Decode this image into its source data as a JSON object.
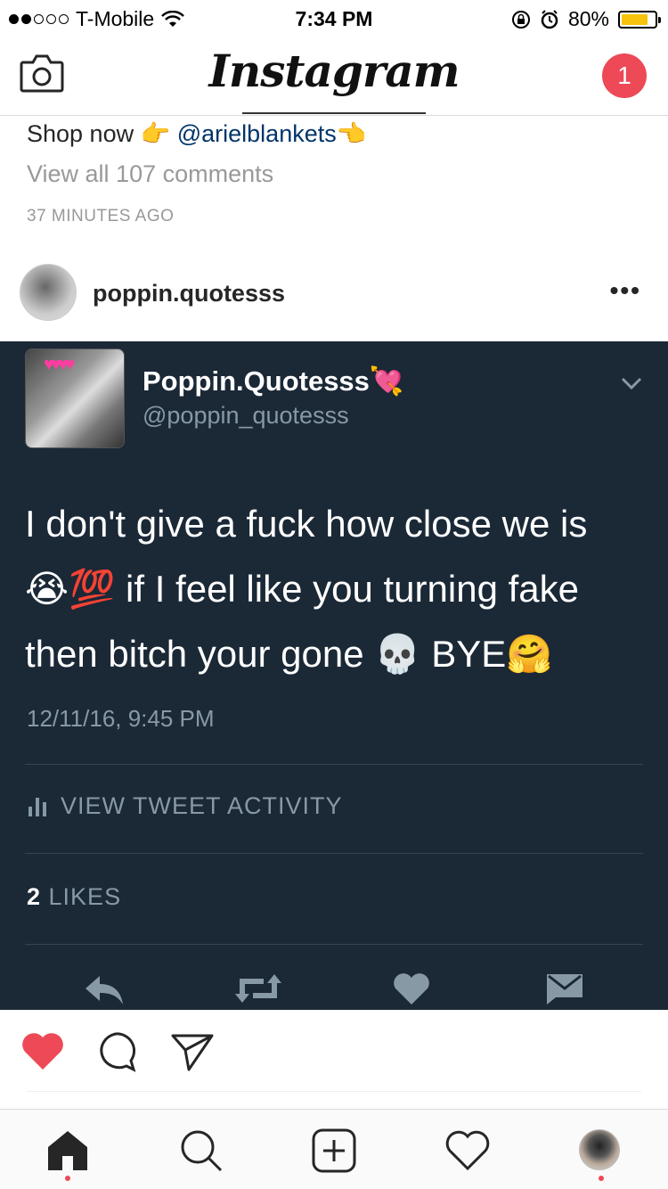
{
  "status_bar": {
    "carrier": "T-Mobile",
    "time": "7:34 PM",
    "battery": "80%",
    "battery_level": 0.8,
    "signal_bars_on": 2,
    "signal_bars_total": 5
  },
  "header": {
    "logo": "Instagram",
    "notification_count": "1",
    "camera_icon": "camera-icon"
  },
  "caption": {
    "prefix": "Shop now ",
    "emoji_before": "👉",
    "mention": "@arielblankets",
    "emoji_after": "👈",
    "view_all": "View all 107 comments",
    "time_ago": "37 MINUTES AGO"
  },
  "post": {
    "username": "poppin.quotesss",
    "more": "•••"
  },
  "tweet": {
    "name": "Poppin.Quotesss",
    "name_emoji": "💘",
    "handle": "@poppin_quotesss",
    "line1": "I don't give a fuck how close we is",
    "line2_emoji": "😭💯",
    "line2": " if I feel like you turning fake",
    "line3": "then bitch your gone ",
    "line3_emoji": "💀",
    "line3_end": " BYE",
    "line3_end_emoji": "🤗",
    "date": "12/11/16, 9:45 PM",
    "activity": "VIEW TWEET ACTIVITY",
    "likes_count": "2",
    "likes_label": " LIKES"
  },
  "colors": {
    "tweet_bg": "#1b2836",
    "tweet_secondary": "#8899a6",
    "like_red": "#ed4956",
    "mention_blue": "#003569"
  }
}
